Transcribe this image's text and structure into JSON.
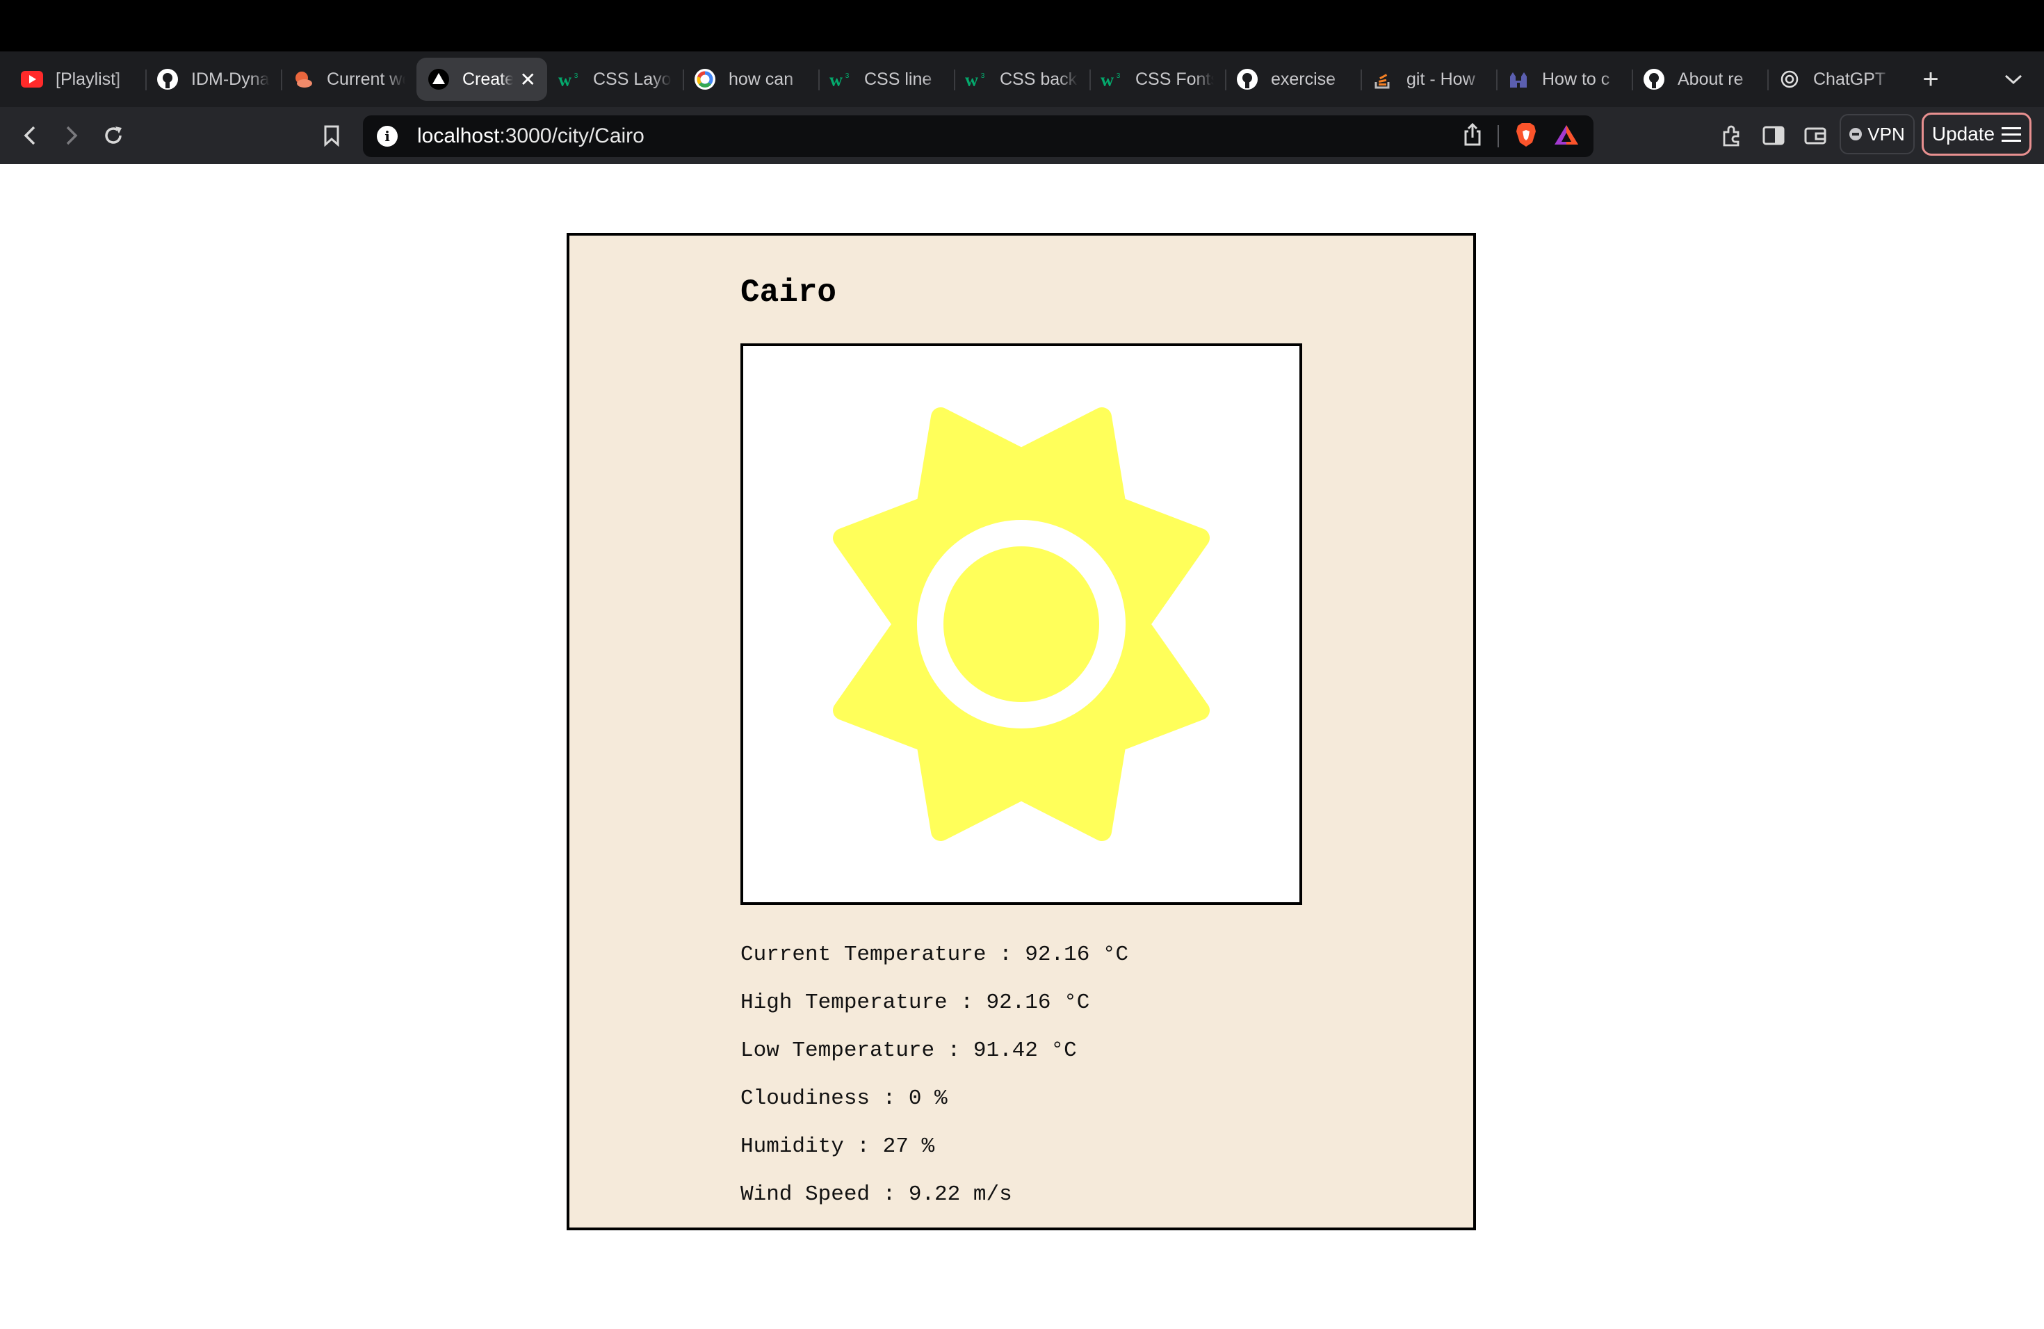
{
  "browser": {
    "tabs": [
      {
        "title": "[Playlist]",
        "icon": "youtube-icon",
        "active": false
      },
      {
        "title": "IDM-Dynamic",
        "icon": "github-icon",
        "active": false
      },
      {
        "title": "Current weather",
        "icon": "weather-app-icon",
        "active": false
      },
      {
        "title": "Create",
        "icon": "vercel-triangle-icon",
        "active": true
      },
      {
        "title": "CSS Layout",
        "icon": "w3schools-icon",
        "active": false
      },
      {
        "title": "how can",
        "icon": "google-icon",
        "active": false
      },
      {
        "title": "CSS line",
        "icon": "w3schools-icon",
        "active": false
      },
      {
        "title": "CSS background",
        "icon": "w3schools-icon",
        "active": false
      },
      {
        "title": "CSS Fonts",
        "icon": "w3schools-icon",
        "active": false
      },
      {
        "title": "exercise",
        "icon": "github-icon",
        "active": false
      },
      {
        "title": "git - How",
        "icon": "stackoverflow-icon",
        "active": false
      },
      {
        "title": "How to c",
        "icon": "castle-icon",
        "active": false
      },
      {
        "title": "About re",
        "icon": "github-icon",
        "active": false
      },
      {
        "title": "ChatGPT",
        "icon": "openai-icon",
        "active": false
      }
    ],
    "new_tab_label": "+",
    "url": {
      "host": "localhost",
      "path": ":3000/city/Cairo"
    },
    "vpn_label": "VPN",
    "update_label": "Update"
  },
  "weather": {
    "city": "Cairo",
    "icon": "sun-icon",
    "sun_color": "#ffff5a",
    "stats": [
      {
        "label": "Current Temperature",
        "value": "92.16 °C"
      },
      {
        "label": "High Temperature",
        "value": "92.16 °C"
      },
      {
        "label": "Low Temperature",
        "value": "91.42 °C"
      },
      {
        "label": "Cloudiness",
        "value": "0 %"
      },
      {
        "label": "Humidity",
        "value": "27 %"
      },
      {
        "label": "Wind Speed",
        "value": "9.22 m/s"
      }
    ]
  }
}
